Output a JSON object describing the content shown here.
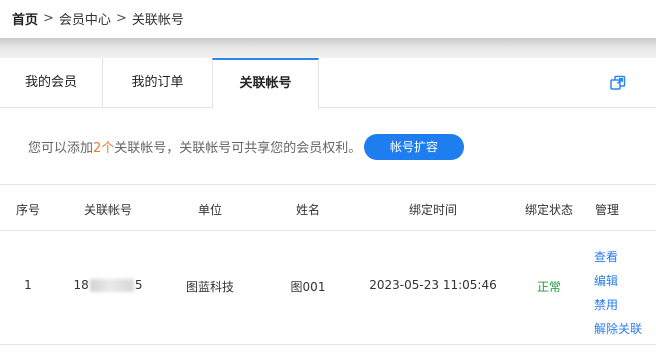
{
  "breadcrumb": {
    "home": "首页",
    "separator": ">",
    "member_center": "会员中心",
    "current": "关联帐号"
  },
  "tabs": [
    {
      "label": "我的会员",
      "active": false
    },
    {
      "label": "我的订单",
      "active": false
    },
    {
      "label": "关联帐号",
      "active": true
    }
  ],
  "icons": {
    "open": "open-in-new-window-icon"
  },
  "info": {
    "prefix": "您可以添加",
    "count": "2个",
    "suffix": "关联帐号，关联帐号可共享您的会员权利。",
    "button": "帐号扩容"
  },
  "table": {
    "headers": [
      "序号",
      "关联帐号",
      "单位",
      "姓名",
      "绑定时间",
      "绑定状态",
      "管理"
    ],
    "rows": [
      {
        "index": "1",
        "account_prefix": "18",
        "account_suffix": "5",
        "unit": "图蓝科技",
        "name": "图001",
        "bind_time": "2023-05-23 11:05:46",
        "status": "正常",
        "actions": [
          "查看",
          "编辑",
          "禁用",
          "解除关联"
        ]
      }
    ]
  },
  "colors": {
    "accent": "#1e7ef0",
    "link": "#2b7ce9",
    "highlight": "#f07a35",
    "status_ok": "#1d9e3a"
  }
}
